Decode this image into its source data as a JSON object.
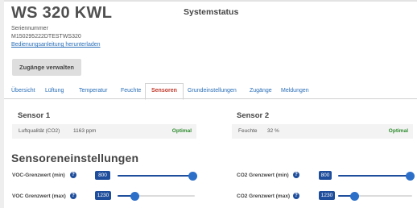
{
  "header": {
    "app_title": "WS 320 KWL",
    "page_heading": "Systemstatus",
    "serial_label": "Seriennummer",
    "serial_value": "M150295222DTESTWS320",
    "manual_link": "Bedienungsanleitung herunterladen",
    "manage_button": "Zugänge verwalten"
  },
  "tabs": [
    {
      "label": "Übersicht",
      "active": false
    },
    {
      "label": "Lüftung",
      "active": false
    },
    {
      "label": "Temperatur",
      "active": false
    },
    {
      "label": "Feuchte",
      "active": false
    },
    {
      "label": "Sensoren",
      "active": true
    },
    {
      "label": "Grundeinstellungen",
      "active": false
    },
    {
      "label": "Zugänge",
      "active": false
    },
    {
      "label": "Meldungen",
      "active": false
    }
  ],
  "sensors": [
    {
      "title": "Sensor 1",
      "label": "Luftqualität (CO2)",
      "value": "1163 ppm",
      "status": "Optimal"
    },
    {
      "title": "Sensor 2",
      "label": "Feuchte",
      "value": "32 %",
      "status": "Optimal"
    }
  ],
  "settings": {
    "title": "Sensoreneinstellungen",
    "help_icon": "?",
    "items": [
      {
        "label": "VOC-Grenzwert (min)",
        "value": "800",
        "level": 0.97
      },
      {
        "label": "VOC Grenzwert (max)",
        "value": "1230",
        "level": 0.22
      },
      {
        "label": "CO2 Grenzwert (min)",
        "value": "800",
        "level": 0.97
      },
      {
        "label": "CO2 Grenzwert (max)",
        "value": "1230",
        "level": 0.22
      }
    ]
  },
  "colors": {
    "accent": "#1f4e9c",
    "active_tab": "#c0392b",
    "status_ok": "#2e8b2e",
    "link": "#2a6fb8"
  }
}
